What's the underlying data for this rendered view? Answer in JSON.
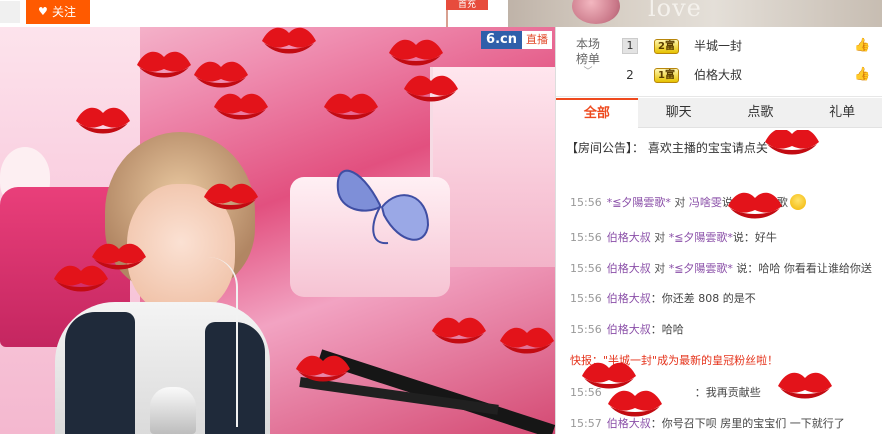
{
  "topbar": {
    "left_chip": "",
    "follow_label": "关注",
    "center_label": "首充",
    "banner_text": "love"
  },
  "video": {
    "brand": "6.cn",
    "live_label": "直播"
  },
  "leaderboard": {
    "title_line1": "本场",
    "title_line2": "榜单",
    "rows": [
      {
        "rank": "1",
        "level": "2富",
        "name": "半城一封"
      },
      {
        "rank": "2",
        "level": "1富",
        "name": "伯格大叔"
      }
    ]
  },
  "tabs": [
    {
      "label": "全部",
      "active": true
    },
    {
      "label": "聊天",
      "active": false
    },
    {
      "label": "点歌",
      "active": false
    },
    {
      "label": "礼单",
      "active": false
    }
  ],
  "chat": {
    "notice_tag": "【房间公告】",
    "notice_text": "：  喜欢主播的宝宝请点关",
    "messages": [
      {
        "time": "15:56",
        "user": "*≦夕陽雲歌*",
        "to_word": " 对 ",
        "target": "冯啥雯",
        "rest": "说：夕阳雪歌",
        "emoji": true
      },
      {
        "time": "15:56",
        "user": "伯格大叔",
        "to_word": " 对 ",
        "target": "*≦夕陽雲歌*",
        "rest": "说：好牛",
        "emoji": false
      },
      {
        "time": "15:56",
        "user": "伯格大叔",
        "to_word": " 对 ",
        "target": "*≦夕陽雲歌*",
        "rest": " 说：哈哈 你看看让谁给你送",
        "emoji": false
      },
      {
        "time": "15:56",
        "user": "伯格大叔",
        "to_word": "",
        "target": "",
        "rest": "：你还差 808 的是不",
        "emoji": false
      },
      {
        "time": "15:56",
        "user": "伯格大叔",
        "to_word": "",
        "target": "",
        "rest": "：哈哈",
        "emoji": false
      }
    ],
    "flash": "快报：\"半城一封\"成为最新的皇冠粉丝啦！",
    "messages_after": [
      {
        "time": "15:56",
        "user": "",
        "to_word": "",
        "target": "",
        "rest": "：我再贡献些",
        "emoji": false
      },
      {
        "time": "15:57",
        "user": "伯格大叔",
        "to_word": "",
        "target": "",
        "rest": "：你号召下呗 房里的宝宝们 一下就行了",
        "emoji": false
      }
    ]
  }
}
